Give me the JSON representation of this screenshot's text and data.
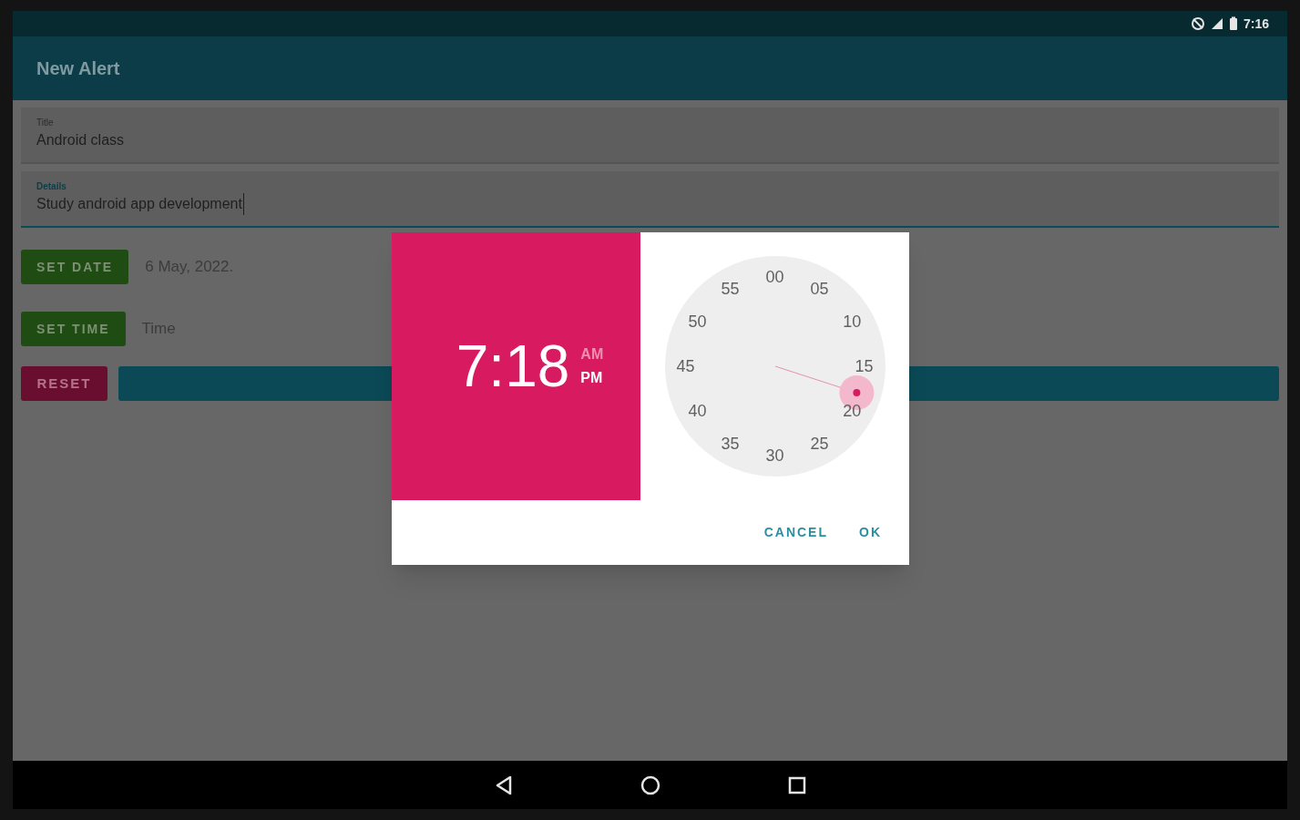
{
  "status_bar": {
    "time": "7:16"
  },
  "app_bar": {
    "title": "New Alert"
  },
  "fields": [
    {
      "label": "Title",
      "value": "Android class",
      "focused": false
    },
    {
      "label": "Details",
      "value": "Study android app development",
      "focused": true
    }
  ],
  "rows": [
    {
      "button": "SET DATE",
      "color": "#1f4c12",
      "value": "6 May, 2022."
    },
    {
      "button": "SET TIME",
      "color": "#1f4c12",
      "value": "Time"
    }
  ],
  "reset_button": {
    "label": "RESET",
    "color": "#6a0e2f"
  },
  "time_dialog": {
    "hour": "7",
    "separator": ":",
    "minute": "18",
    "periods": [
      {
        "label": "AM",
        "selected": false
      },
      {
        "label": "PM",
        "selected": true
      }
    ],
    "dial": [
      "00",
      "05",
      "10",
      "15",
      "20",
      "25",
      "30",
      "35",
      "40",
      "45",
      "50",
      "55"
    ],
    "buttons": [
      "CANCEL",
      "OK"
    ]
  }
}
